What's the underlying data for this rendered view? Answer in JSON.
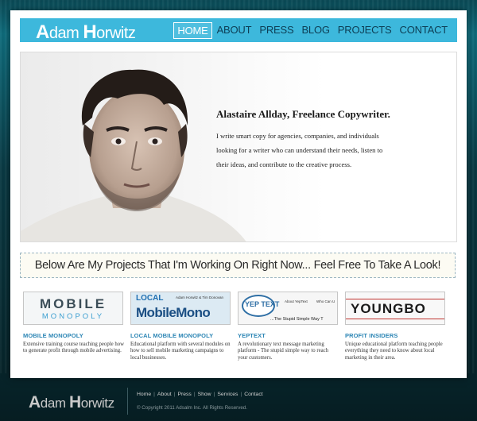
{
  "header": {
    "logo": {
      "first_initial": "A",
      "first_rest": "dam ",
      "last_initial": "H",
      "last_rest": "orwitz"
    },
    "nav": [
      {
        "label": "HOME",
        "active": true
      },
      {
        "label": "ABOUT",
        "active": false
      },
      {
        "label": "PRESS",
        "active": false
      },
      {
        "label": "BLOG",
        "active": false
      },
      {
        "label": "PROJECTS",
        "active": false
      },
      {
        "label": "CONTACT",
        "active": false
      }
    ]
  },
  "hero": {
    "title": "Alastaire Allday, Freelance Copywriter.",
    "body": "I write smart copy for agencies, companies, and individuals looking for a writer who can understand their needs, listen to their ideas, and contribute to the creative process."
  },
  "banner": {
    "text": "Below Are My Projects That I'm Working On Right Now... Feel Free To Take A Look!"
  },
  "projects": [
    {
      "title": "MOBILE MONOPOLY",
      "description": "Extensive training course teaching people how to generate profit through mobile advertising.",
      "thumb": {
        "line1": "MOBILE",
        "line2": "MONOPOLY"
      }
    },
    {
      "title": "LOCAL MOBILE MONOPOLY",
      "description": "Educational platform with several modules on how to sell mobile marketing campaigns to local businesses.",
      "thumb": {
        "line1": "LOCAL",
        "line2": "MobileMono",
        "byline": "Adam Horwitz & Tim Donovan"
      }
    },
    {
      "title": "YEPTEXT",
      "description": "A revolutionary text message marketing platform - The stupid simple way to reach your customers.",
      "thumb": {
        "logo": "YEP TEXT",
        "about": "About YepText",
        "who": "Who Can U",
        "tagline": "...The Stupid Simple Way T"
      }
    },
    {
      "title": "PROFIT INSIDERS",
      "description": "Unique educational platform teaching people everything they need to know about local marketing in their area.",
      "thumb": {
        "logo": "YOUNGBO"
      }
    }
  ],
  "footer": {
    "logo": {
      "first_initial": "A",
      "first_rest": "dam ",
      "last_initial": "H",
      "last_rest": "orwitz"
    },
    "links": [
      "Home",
      "About",
      "Press",
      "Show",
      "Services",
      "Contact"
    ],
    "copyright": "© Copyright 2011 Adsalm Inc. All Rights Reserved."
  },
  "colors": {
    "accent": "#3db8dc",
    "project_title": "#2d86b5",
    "nav_text": "#0d3e55"
  }
}
